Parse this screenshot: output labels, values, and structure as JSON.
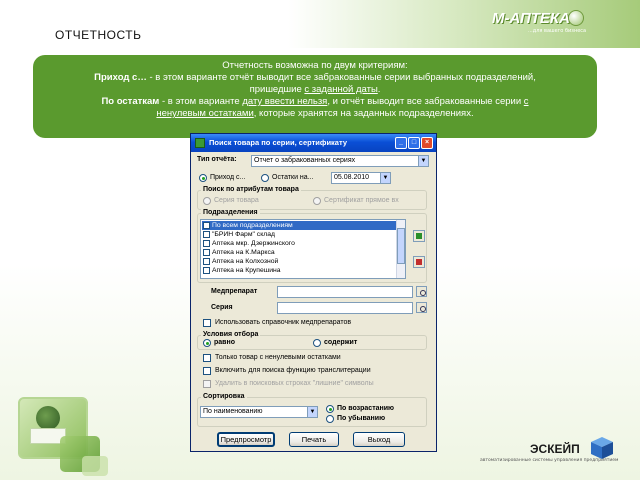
{
  "slide": {
    "title": "ОТЧЕТНОСТЬ",
    "logo_top": {
      "brand": "М-АПТЕКА",
      "subtitle": "...для вашего бизнеса"
    },
    "logo_bottom": {
      "name": "ЭСКЕЙП",
      "tagline": "автоматизированные системы управления предприятием"
    },
    "colors": {
      "accent": "#5a9a2e",
      "info_text": "#ffffff"
    }
  },
  "info": {
    "line1": "Отчетность возможна по двум критериям:",
    "l2_bold": "Приход с…",
    "l2_text": " - в этом варианте отчёт выводит все забракованные серии выбранных подразделений,",
    "l3_text": "пришедшие ",
    "l3_link": "с заданной даты",
    "l3_end": ".",
    "l4_bold": "По остаткам",
    "l4_text": " - в этом варианте ",
    "l4_link": "дату ввести нельзя",
    "l4_text2": ", и отчёт выводит все забракованные серии ",
    "l4_link2": "с",
    "l5_link": "ненулевым остатками",
    "l5_text": ", которые хранятся на заданных подразделениях."
  },
  "dialog": {
    "title": "Поиск товара по серии, сертификату",
    "report_type_label": "Тип отчёта:",
    "report_type_value": "Отчет о забракованных сериях",
    "radio_income": "Приход с...",
    "radio_stock": "Остатки на...",
    "date_value": "05.08.2010",
    "search_group": "Поиск по атрибутам товара",
    "search_opt1": "Серия товара",
    "search_opt2": "Сертификат прямое вх",
    "divisions_group": "Подразделения",
    "divisions": [
      "По всем подразделениям",
      "\"БРИН Фарм\" склад",
      "Аптека мкр. Дзержинского",
      "Аптека на К.Маркса",
      "Аптека на Колхозной",
      "Аптека на Крупешина"
    ],
    "drug_label": "Медпрепарат",
    "series_label": "Серия",
    "use_catalog": "Использовать справочник медпрепаратов",
    "condition_group": "Условия отбора",
    "cond_equal": "равно",
    "cond_contains": "содержит",
    "only_nonzero": "Только товар с ненулевыми остатками",
    "transliteration": "Включить для поиска функцию транслитерации",
    "remove_spaces": "Удалить в поисковых строках \"лишние\" символы",
    "sort_group": "Сортировка",
    "sort_value": "По наименованию",
    "sort_asc": "По возрастанию",
    "sort_desc": "По убыванию",
    "btn_preview": "Предпросмотр",
    "btn_print": "Печать",
    "btn_exit": "Выход"
  }
}
